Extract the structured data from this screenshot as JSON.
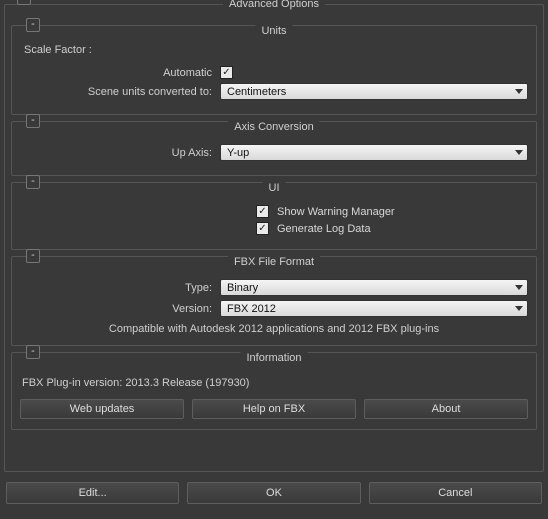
{
  "outer": {
    "title": "Advanced Options"
  },
  "units": {
    "title": "Units",
    "scale_factor_label": "Scale Factor :",
    "automatic_label": "Automatic",
    "automatic_checked": true,
    "converted_label": "Scene units converted to:",
    "converted_value": "Centimeters"
  },
  "axis": {
    "title": "Axis Conversion",
    "up_axis_label": "Up Axis:",
    "up_axis_value": "Y-up"
  },
  "ui": {
    "title": "UI",
    "show_warning_label": "Show Warning Manager",
    "show_warning_checked": true,
    "generate_log_label": "Generate Log Data",
    "generate_log_checked": true
  },
  "fbx": {
    "title": "FBX File Format",
    "type_label": "Type:",
    "type_value": "Binary",
    "version_label": "Version:",
    "version_value": "FBX 2012",
    "compat_note": "Compatible with Autodesk 2012 applications and 2012 FBX plug-ins"
  },
  "info": {
    "title": "Information",
    "plugin_version": "FBX Plug-in version: 2013.3 Release (197930)",
    "web_updates": "Web updates",
    "help": "Help on FBX",
    "about": "About"
  },
  "footer": {
    "edit": "Edit...",
    "ok": "OK",
    "cancel": "Cancel"
  },
  "collapse_glyph": "-"
}
